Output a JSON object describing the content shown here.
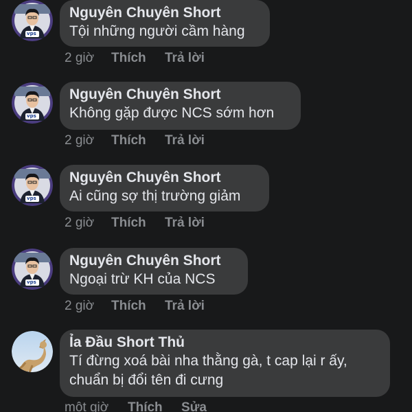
{
  "comments": [
    {
      "author": "Nguyên Chuyên Short",
      "text": "Tội những người cầm hàng",
      "time": "2 giờ",
      "like": "Thích",
      "reply": "Trả lời",
      "avatar_badge": "vps"
    },
    {
      "author": "Nguyên Chuyên Short",
      "text": "Không gặp được NCS sớm hơn",
      "time": "2 giờ",
      "like": "Thích",
      "reply": "Trả lời",
      "avatar_badge": "vps"
    },
    {
      "author": "Nguyên Chuyên Short",
      "text": "Ai cũng sợ thị trường giảm",
      "time": "2 giờ",
      "like": "Thích",
      "reply": "Trả lời",
      "avatar_badge": "vps"
    },
    {
      "author": "Nguyên Chuyên Short",
      "text": "Ngoại trừ KH của NCS",
      "time": "2 giờ",
      "like": "Thích",
      "reply": "Trả lời",
      "avatar_badge": "vps"
    },
    {
      "author": "Ỉa Đầu Short Thủ",
      "text_lines": [
        "Tí đừng xoá bài nha thằng gà, t cap lại r ấy,",
        "chuẩn bị đổi tên đi cưng"
      ],
      "time": "một giờ",
      "like": "Thích",
      "edit": "Sửa"
    }
  ],
  "colors": {
    "background": "#18191a",
    "bubble": "#3a3b3c",
    "text": "#e4e6eb",
    "meta": "#8a8d91",
    "avatar_ring": "#5b4a8e"
  }
}
